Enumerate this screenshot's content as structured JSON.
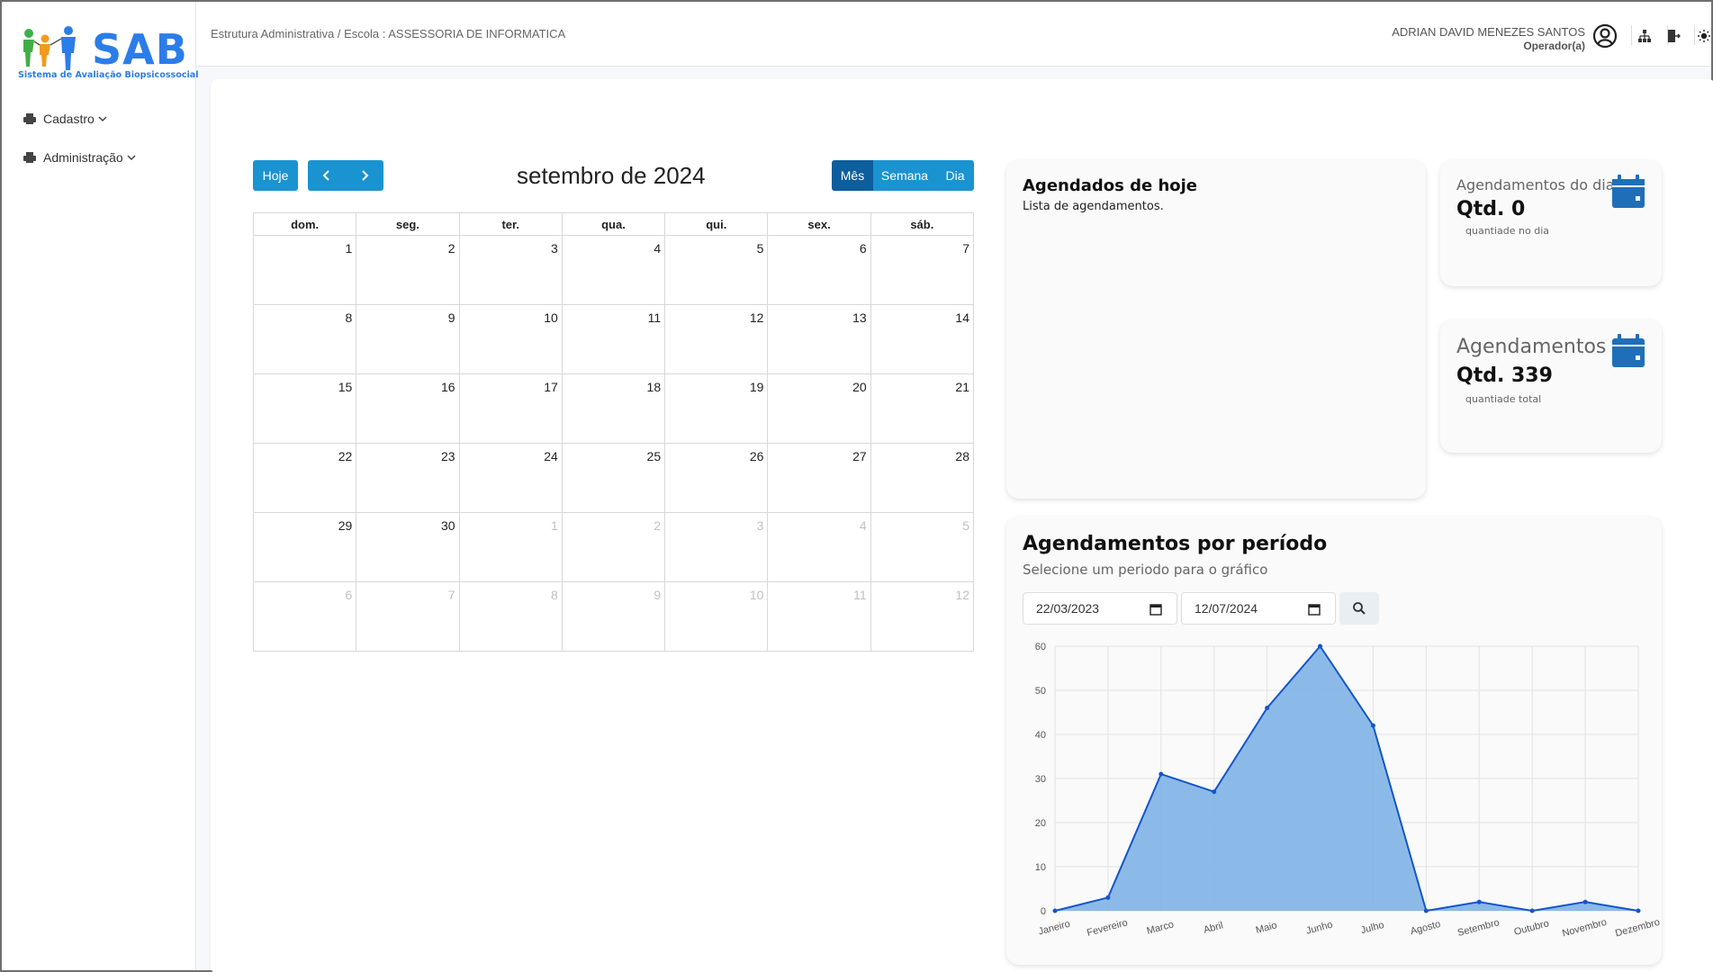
{
  "logo": {
    "text": "SAB",
    "subtitle": "Sistema de Avaliação Biopsicossocial"
  },
  "sidebar": {
    "items": [
      {
        "label": "Cadastro"
      },
      {
        "label": "Administração"
      }
    ]
  },
  "header": {
    "breadcrumb": "Estrutura Administrativa / Escola : ASSESSORIA DE INFORMATICA",
    "user_name": "ADRIAN DAVID MENEZES SANTOS",
    "user_role": "Operador(a)"
  },
  "calendar": {
    "today_label": "Hoje",
    "title": "setembro de 2024",
    "views": [
      {
        "label": "Mês",
        "active": true
      },
      {
        "label": "Semana",
        "active": false
      },
      {
        "label": "Dia",
        "active": false
      }
    ],
    "weekdays": [
      "dom.",
      "seg.",
      "ter.",
      "qua.",
      "qui.",
      "sex.",
      "sáb."
    ],
    "weeks": [
      [
        "1",
        "2",
        "3",
        "4",
        "5",
        "6",
        "7"
      ],
      [
        "8",
        "9",
        "10",
        "11",
        "12",
        "13",
        "14"
      ],
      [
        "15",
        "16",
        "17",
        "18",
        "19",
        "20",
        "21"
      ],
      [
        "22",
        "23",
        "24",
        "25",
        "26",
        "27",
        "28"
      ],
      [
        "29",
        "30",
        "1",
        "2",
        "3",
        "4",
        "5"
      ],
      [
        "6",
        "7",
        "8",
        "9",
        "10",
        "11",
        "12"
      ]
    ]
  },
  "today_card": {
    "title": "Agendados de hoje",
    "subtitle": "Lista de agendamentos."
  },
  "stats": [
    {
      "label": "Agendamentos do dia",
      "value": "Qtd. 0",
      "sub": "quantiade no dia"
    },
    {
      "label": "Agendamentos",
      "value": "Qtd. 339",
      "sub": "quantiade total"
    }
  ],
  "period": {
    "title": "Agendamentos por período",
    "subtitle": "Selecione um periodo para o gráfico",
    "start_date": "22/03/2023",
    "end_date": "12/07/2024"
  },
  "colors": {
    "accent": "#1a93d1",
    "accent_dark": "#0d5e9c",
    "chart_line": "#1456c8",
    "chart_fill": "#7fb3e6"
  },
  "chart_data": {
    "type": "area",
    "categories": [
      "Janeiro",
      "Fevereiro",
      "Marco",
      "Abril",
      "Maio",
      "Junho",
      "Julho",
      "Agosto",
      "Setembro",
      "Outubro",
      "Novembro",
      "Dezembro"
    ],
    "series": [
      {
        "values": [
          0,
          3,
          31,
          27,
          46,
          60,
          42,
          0,
          2,
          0,
          2,
          0
        ]
      }
    ],
    "ylim": [
      0,
      60
    ],
    "yticks": [
      0,
      10,
      20,
      30,
      40,
      50,
      60
    ],
    "grid": true
  }
}
